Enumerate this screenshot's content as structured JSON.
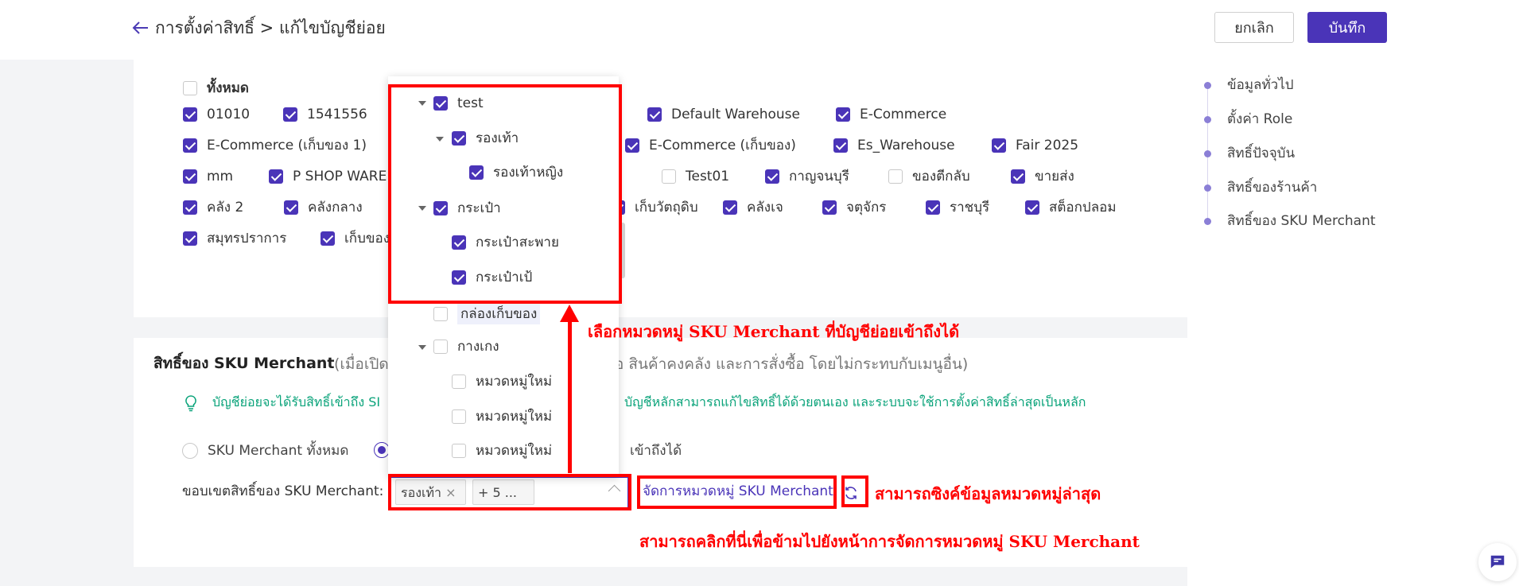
{
  "header": {
    "breadcrumb": "การตั้งค่าสิทธิ์ > แก้ไขบัญชีย่อย",
    "cancel_label": "ยกเลิก",
    "save_label": "บันทึก"
  },
  "warehouses": {
    "all_label": "ทั้งหมด",
    "items": [
      {
        "label": "01010",
        "checked": true
      },
      {
        "label": "1541556",
        "checked": true
      },
      {
        "label": "Default Warehouse",
        "checked": true
      },
      {
        "label": "E-Commerce",
        "checked": true
      },
      {
        "label": "E-Commerce (เก็บของ 1)",
        "checked": true
      },
      {
        "label": "E-Commerce (เก็บของ)",
        "checked": true
      },
      {
        "label": "Es_Warehouse",
        "checked": true
      },
      {
        "label": "Fair 2025",
        "checked": true
      },
      {
        "label": "mm",
        "checked": true
      },
      {
        "label": "P SHOP WARE",
        "checked": true
      },
      {
        "label": "Test01",
        "checked": false
      },
      {
        "label": "กาญจนบุรี",
        "checked": true
      },
      {
        "label": "ของตีกลับ",
        "checked": false
      },
      {
        "label": "ขายส่ง",
        "checked": true
      },
      {
        "label": "คลัง 2",
        "checked": true
      },
      {
        "label": "คลังกลาง",
        "checked": true
      },
      {
        "label": "เก็บวัตถุดิบ",
        "checked": true
      },
      {
        "label": "คลังเจ",
        "checked": true
      },
      {
        "label": "จตุจักร",
        "checked": true
      },
      {
        "label": "ราชบุรี",
        "checked": true
      },
      {
        "label": "สต็อกปลอม",
        "checked": true
      },
      {
        "label": "สมุทรปราการ",
        "checked": true
      },
      {
        "label": "เก็บของ",
        "checked": true
      }
    ]
  },
  "sku_section": {
    "title": "สิทธิ์ของ SKU Merchant",
    "note_left": "(เมื่อเปิด",
    "note_right": "ซื้อ สินค้าคงคลัง และการสั่งซื้อ โดยไม่กระทบกับเมนูอื่น)",
    "tip_left": "บัญชีย่อยจะได้รับสิทธิ์เข้าถึง SI",
    "tip_right": "บัญชีหลักสามารถแก้ไขสิทธิ์ได้ด้วยตนเอง และระบบจะใช้การตั้งค่าสิทธิ์ล่าสุดเป็นหลัก",
    "radio_all": "SKU Merchant ทั้งหมด",
    "radio_selected_tail": "เข้าถึงได้",
    "scope_label": "ขอบเขตสิทธิ์ของ SKU Merchant:",
    "tag1": "รองเท้า",
    "tag1_close": "×",
    "tag2": "+ 5 ...",
    "manage_link": "จัดการหมวดหมู่ SKU Merchant"
  },
  "dropdown": {
    "items": [
      {
        "label": "test",
        "checked": true
      },
      {
        "label": "รองเท้า",
        "checked": true
      },
      {
        "label": "รองเท้าหญิง",
        "checked": true
      },
      {
        "label": "กระเป๋า",
        "checked": true
      },
      {
        "label": "กระเป๋าสะพาย",
        "checked": true
      },
      {
        "label": "กระเป๋าเป้",
        "checked": true
      },
      {
        "label": "กล่องเก็บของ",
        "checked": false
      },
      {
        "label": "กางเกง",
        "checked": false
      },
      {
        "label": "หมวดหมู่ใหม่",
        "checked": false
      },
      {
        "label": "หมวดหมู่ใหม่",
        "checked": false
      },
      {
        "label": "หมวดหมู่ใหม่",
        "checked": false
      }
    ]
  },
  "right_nav": {
    "items": [
      "ข้อมูลทั่วไป",
      "ตั้งค่า Role",
      "สิทธิ์ปัจจุบัน",
      "สิทธิ์ของร้านค้า",
      "สิทธิ์ของ SKU Merchant"
    ]
  },
  "annotations": {
    "select_category": "เลือกหมวดหมู่ SKU Merchant ที่บัญชีย่อยเข้าถึงได้",
    "sync_latest": "สามารถซิงค์ข้อมูลหมวดหมู่ล่าสุด",
    "click_to_manage": "สามารถคลิกที่นี่เพื่อข้ามไปยังหน้าการจัดการหมวดหมู่ SKU Merchant"
  },
  "colors": {
    "accent": "#4a34b8",
    "tip_text": "#0aa37a",
    "annotation": "#ff0000"
  }
}
